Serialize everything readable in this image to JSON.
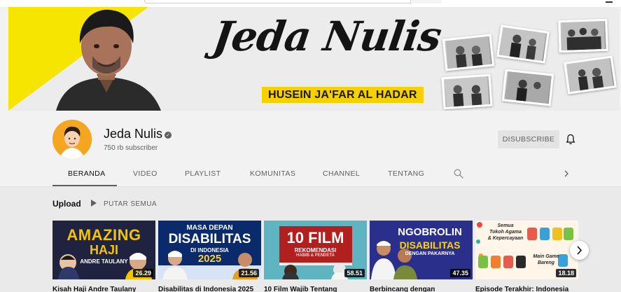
{
  "banner": {
    "title": "Jeda Nulis",
    "subtitle": "HUSEIN JA'FAR AL HADAR"
  },
  "channel": {
    "name": "Jeda Nulis",
    "subscribers": "750 rb subscriber",
    "unsubscribe_label": "DISUBSCRIBE"
  },
  "tabs": [
    {
      "label": "BERANDA",
      "active": true
    },
    {
      "label": "VIDEO"
    },
    {
      "label": "PLAYLIST"
    },
    {
      "label": "KOMUNITAS"
    },
    {
      "label": "CHANNEL"
    },
    {
      "label": "TENTANG"
    }
  ],
  "section": {
    "title": "Upload",
    "play_all": "PUTAR SEMUA"
  },
  "videos": [
    {
      "title": "Kisah Haji Andre Taulany",
      "duration": "26.29",
      "thumb_text_1": "AMAZING",
      "thumb_text_2": "HAJI",
      "thumb_text_3": "ANDRE TAULANY"
    },
    {
      "title": "Disabilitas di Indonesia 2025",
      "duration": "21.56",
      "thumb_text_1": "MASA DEPAN",
      "thumb_text_2": "DISABILITAS",
      "thumb_text_3": "DI INDONESIA",
      "thumb_text_4": "2025"
    },
    {
      "title": "10 Film Wajib Tentang",
      "duration": "58.51",
      "thumb_text_1": "10 FILM",
      "thumb_text_2": "REKOMENDASI",
      "thumb_text_3": "HABIB & PENDETA"
    },
    {
      "title": "Berbincang dengan",
      "duration": "47.35",
      "thumb_text_1": "NGOBROLIN",
      "thumb_text_2": "DISABILITAS",
      "thumb_text_3": "DENGAN PAKARNYA"
    },
    {
      "title": "Episode Terakhir: Indonesia",
      "duration": "18.18",
      "thumb_text_1": "Semua",
      "thumb_text_2": "Tokoh Agama",
      "thumb_text_3": "& Kepercayaan",
      "thumb_text_4": "Main Game",
      "thumb_text_5": "Bareng"
    }
  ],
  "colors": {
    "banner_yellow": "#f6e500",
    "subtitle_yellow": "#f7d000",
    "avatar_orange": "#f4a623",
    "thumb1_bg": "#1f2340",
    "thumb1_accent": "#f5c400",
    "thumb2_bg": "#0b2a6b",
    "thumb3_bg": "#5fb4c2",
    "thumb3_card": "#b11f1f",
    "thumb4_bg": "#2a2f8c",
    "thumb5_bg": "#fff5e8"
  },
  "icons": {
    "verified": "check-circle-icon",
    "bell": "bell-icon",
    "search": "search-icon",
    "chevron": "chevron-right-icon",
    "play": "play-icon",
    "next": "chevron-right-icon"
  }
}
